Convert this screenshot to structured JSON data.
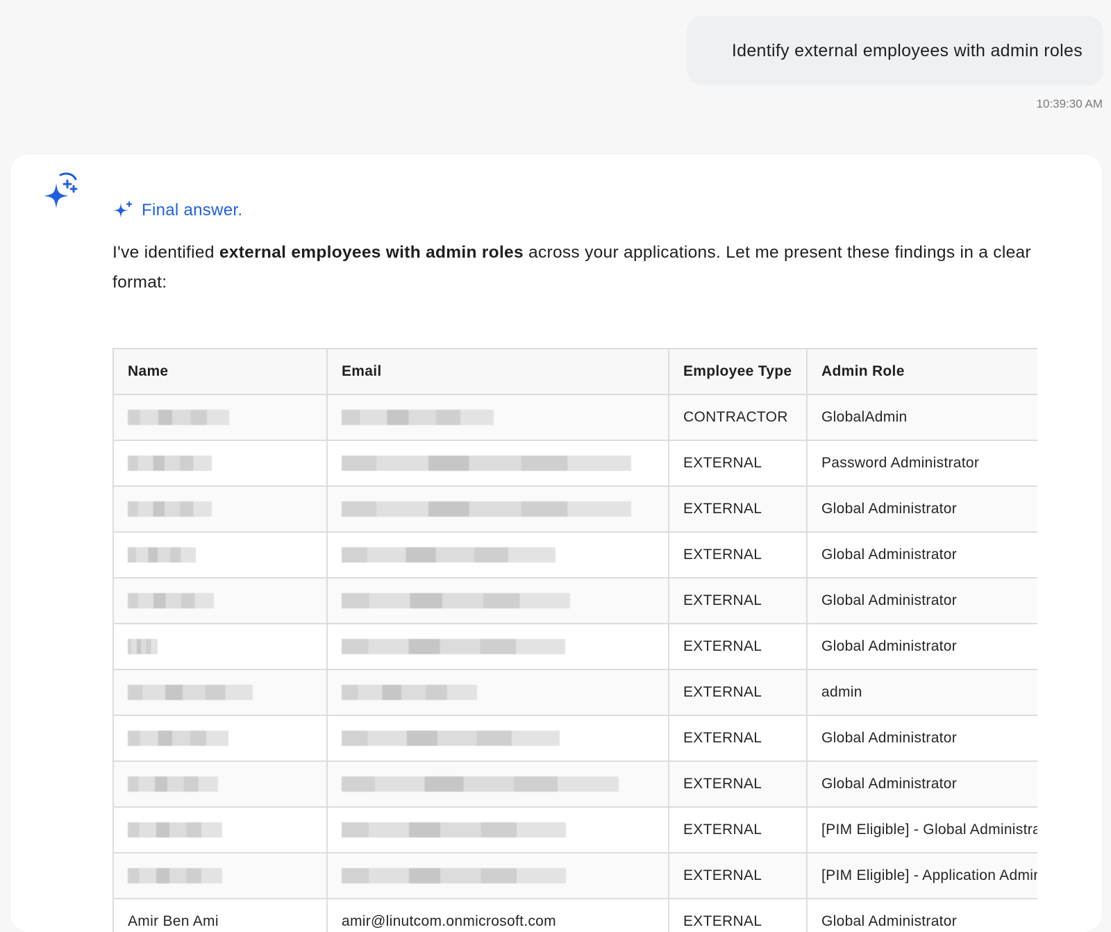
{
  "user_message": {
    "text": "Identify external employees with admin roles",
    "timestamp": "10:39:30 AM"
  },
  "answer": {
    "status_label": "Final answer.",
    "intro_pre": "I've identified ",
    "intro_bold": "external employees with admin roles",
    "intro_post": " across your applications. Let me present these findings in a clear format:"
  },
  "table": {
    "headers": [
      "Name",
      "Email",
      "Employee Type",
      "Admin Role"
    ],
    "rows": [
      {
        "name_redacted": true,
        "email_redacted": true,
        "type": "CONTRACTOR",
        "role": "GlobalAdmin"
      },
      {
        "name_redacted": true,
        "email_redacted": true,
        "type": "EXTERNAL",
        "role": "Password Administrator"
      },
      {
        "name_redacted": true,
        "email_redacted": true,
        "type": "EXTERNAL",
        "role": "Global Administrator"
      },
      {
        "name_redacted": true,
        "email_redacted": true,
        "type": "EXTERNAL",
        "role": "Global Administrator"
      },
      {
        "name_redacted": true,
        "email_redacted": true,
        "type": "EXTERNAL",
        "role": "Global Administrator"
      },
      {
        "name_redacted": true,
        "email_redacted": true,
        "type": "EXTERNAL",
        "role": "Global Administrator"
      },
      {
        "name_redacted": true,
        "email_redacted": true,
        "type": "EXTERNAL",
        "role": "admin"
      },
      {
        "name_redacted": true,
        "email_redacted": true,
        "type": "EXTERNAL",
        "role": "Global Administrator"
      },
      {
        "name_redacted": true,
        "email_redacted": true,
        "type": "EXTERNAL",
        "role": "Global Administrator"
      },
      {
        "name_redacted": true,
        "email_redacted": true,
        "type": "EXTERNAL",
        "role": "[PIM Eligible] - Global Administrator"
      },
      {
        "name_redacted": true,
        "email_redacted": true,
        "type": "EXTERNAL",
        "role": "[PIM Eligible] - Application Administrator"
      },
      {
        "name": "Amir Ben Ami",
        "email": "amir@linutcom.onmicrosoft.com",
        "type": "EXTERNAL",
        "role": "Global Administrator"
      }
    ]
  },
  "colors": {
    "accent": "#1f5fe0",
    "page_bg": "#f7f7f8",
    "bubble_bg": "#eef0f2"
  },
  "icons": {
    "assistant_avatar": "sparkle-stars-icon",
    "final_answer": "sparkle-icon"
  }
}
